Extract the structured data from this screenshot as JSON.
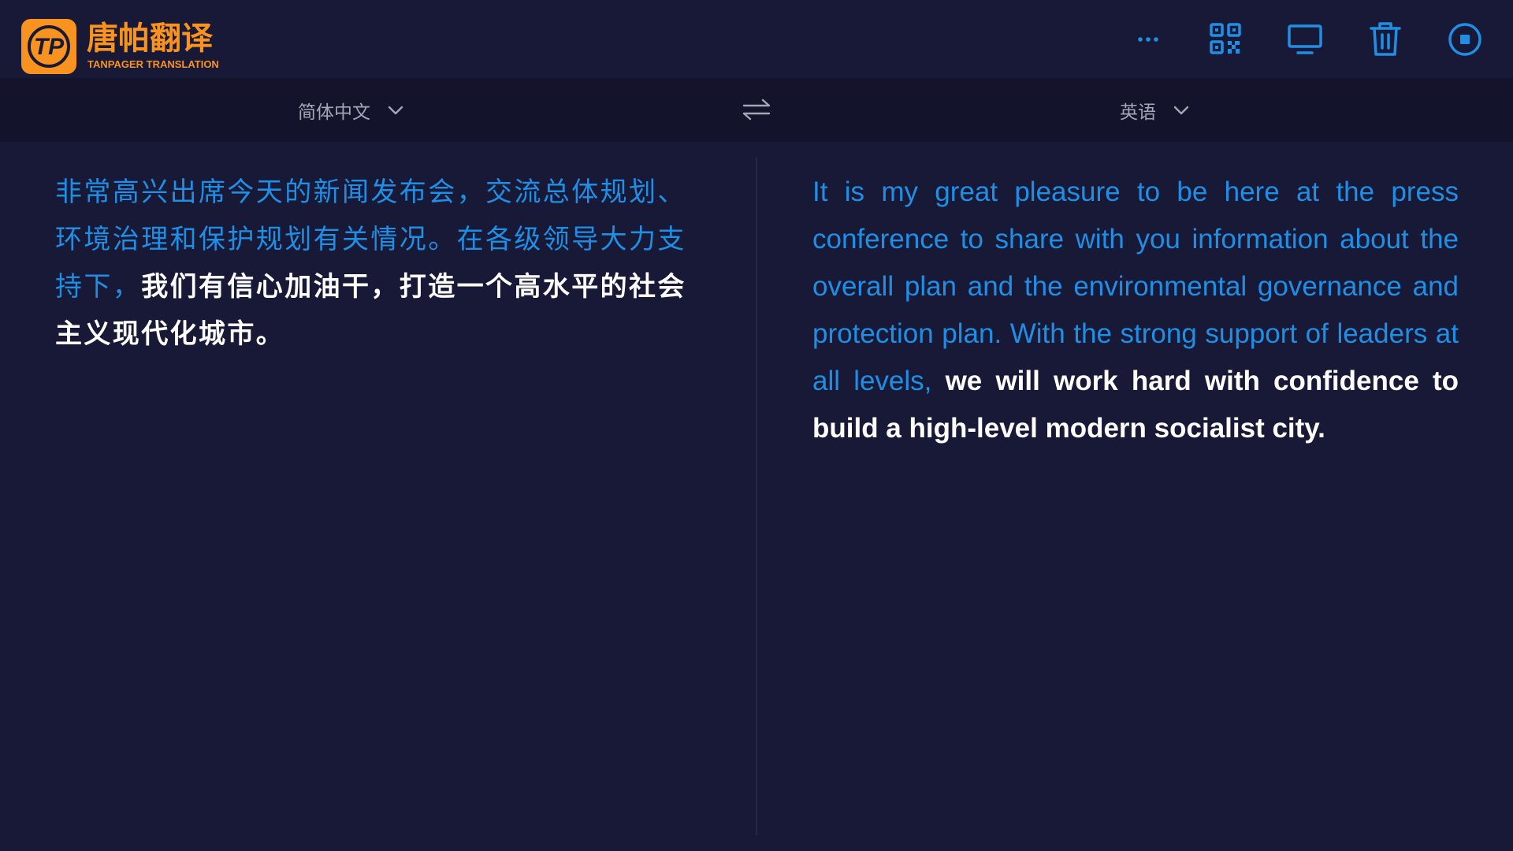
{
  "app": {
    "brand_title": "唐帕翻译",
    "brand_subtitle": "TANPAGER TRANSLATION",
    "logo_text": "TP",
    "brand_color": "#f7931e",
    "accent_color": "#1f8fe6",
    "background_color": "#181936"
  },
  "toolbar": {
    "items": [
      {
        "icon": "more-icon"
      },
      {
        "icon": "qr-code-icon"
      },
      {
        "icon": "monitor-icon"
      },
      {
        "icon": "trash-icon"
      },
      {
        "icon": "stop-icon"
      }
    ]
  },
  "languages": {
    "source": "简体中文",
    "target": "英语",
    "swap_icon": "swap-icon"
  },
  "source_text": {
    "done": "非常高兴出席今天的新闻发布会，交流总体规划、环境治理和保护规划有关情况。在各级领导大力支持下，",
    "live": "我们有信心加油干，打造一个高水平的社会主义现代化城市。"
  },
  "target_text": {
    "done": "It is my great pleasure to be here at the press conference to share with you information about the overall plan and the environmental governance and protection plan. With the strong support of leaders at all levels, ",
    "live": "we will work hard with confidence to build a high-level modern socialist city."
  }
}
